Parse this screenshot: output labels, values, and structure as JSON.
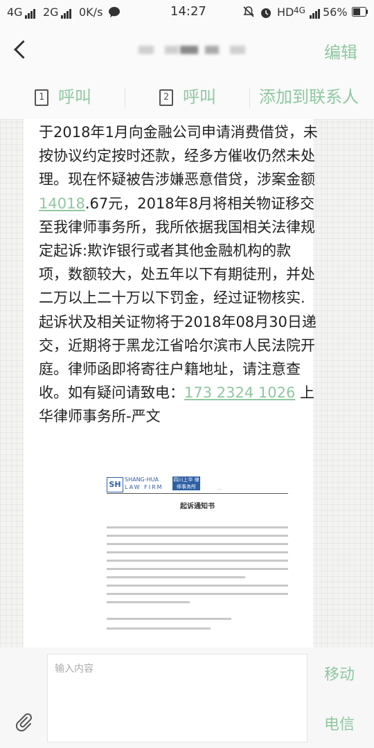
{
  "status_bar": {
    "network1": "4G",
    "network2": "2G",
    "speed": "0K/s",
    "time": "14:27",
    "hd": "HD",
    "network3": "4G",
    "battery": "56%"
  },
  "header": {
    "back_icon": "chevron-left-icon",
    "edit_label": "编辑"
  },
  "actions": {
    "call1_sim": "1",
    "call1_label": "呼叫",
    "call2_sim": "2",
    "call2_label": "呼叫",
    "add_contact_label": "添加到联系人"
  },
  "message": {
    "text_1": "于2018年1月向金融公司申请消费借贷，未按协议约定按时还款，经多方催收仍然未处理。现在怀疑被告涉嫌恶意借贷，涉案金额",
    "amount_link": "14018",
    "text_2": ".67元，2018年8月将相关物证移交至我律师事务所，我所依据我国相关法律规定起诉:欺诈银行或者其他金融机构的款项，数额较大，处五年以下有期徒刑，并处二万以上二十万以下罚金，经过证物核实.起诉状及相关证物将于2018年08月30日递交，近期将于黑龙江省哈尔滨市人民法院开庭。律师函即将寄往户籍地址，请注意查收。如有疑问请致电：",
    "phone_link": "173 2324 1026",
    "text_3": "  上华律师事务所-严文"
  },
  "attachment": {
    "logo_abbr": "SH",
    "firm_en_1": "SHANG-HUA",
    "firm_en_2": "LAW FIRM",
    "firm_cn": "四川上华 律师事务所",
    "doc_title": "起诉通知书"
  },
  "input_bar": {
    "placeholder": "输入内容",
    "send_carrier1": "移动",
    "send_carrier2": "电信"
  }
}
